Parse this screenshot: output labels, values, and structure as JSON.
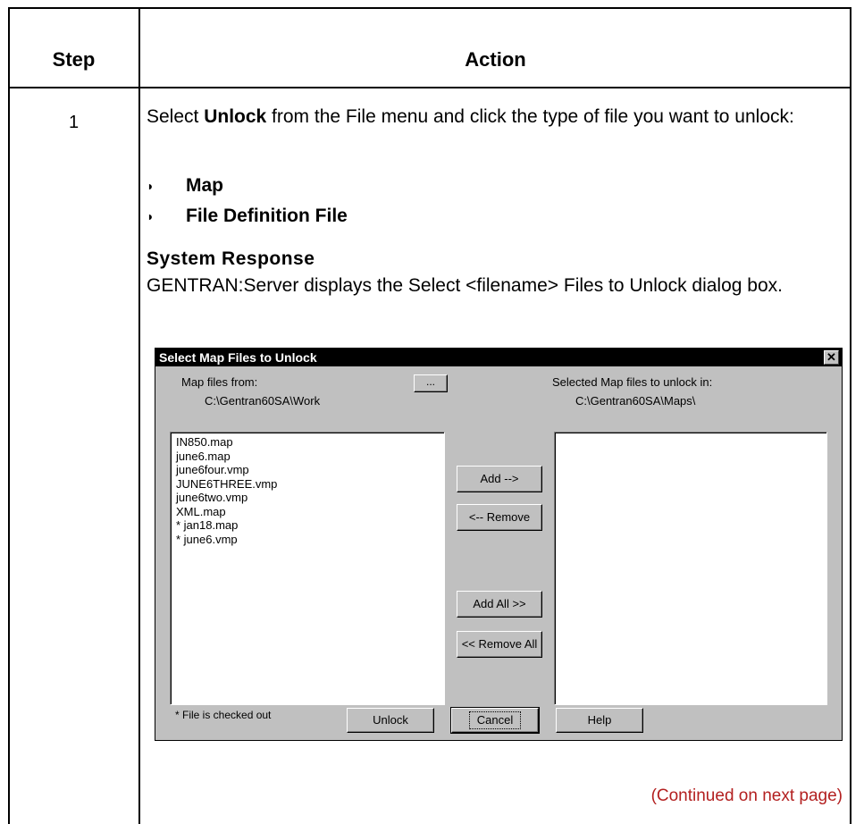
{
  "table": {
    "header_step": "Step",
    "header_action": "Action",
    "step_number": "1",
    "instruction_pre": "Select ",
    "instruction_bold": "Unlock",
    "instruction_post": " from the File menu and click the type of file you want to unlock:",
    "bullets": [
      "Map",
      "File Definition File"
    ],
    "system_response_title": "System Response",
    "system_response_text": "GENTRAN:Server displays the Select <filename> Files to Unlock dialog box.",
    "continued": "(Continued on next page)"
  },
  "dialog": {
    "title": "Select Map Files to Unlock",
    "close_glyph": "✕",
    "map_files_from_label": "Map files from:",
    "source_path": "C:\\Gentran60SA\\Work",
    "browse_label": "...",
    "selected_label": "Selected Map files to unlock in:",
    "dest_path": "C:\\Gentran60SA\\Maps\\",
    "files": [
      " IN850.map",
      " june6.map",
      " june6four.vmp",
      " JUNE6THREE.vmp",
      " june6two.vmp",
      " XML.map",
      "* jan18.map",
      "* june6.vmp"
    ],
    "selected_files": [],
    "add_label": "Add -->",
    "remove_label": "<-- Remove",
    "add_all_label": "Add All  >>",
    "remove_all_label": "<< Remove All",
    "footnote": "* File is checked out",
    "unlock_label": "Unlock",
    "cancel_label": "Cancel",
    "help_label": "Help"
  }
}
